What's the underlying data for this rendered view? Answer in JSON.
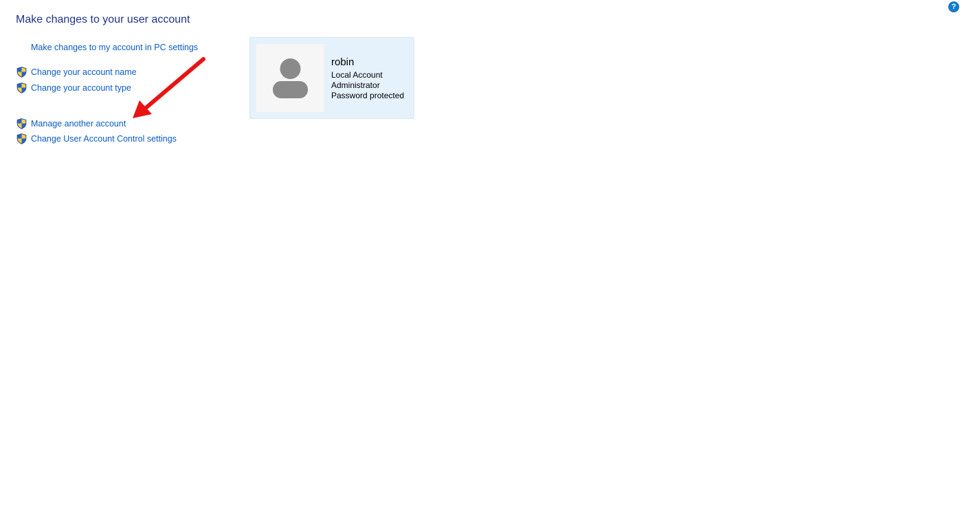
{
  "header": {
    "title": "Make changes to your user account",
    "help_icon": "help-icon",
    "help_label": "?"
  },
  "tasks": {
    "pc_settings": "Make changes to my account in PC settings",
    "change_name": "Change your account name",
    "change_type": "Change your account type",
    "manage_another": "Manage another account",
    "uac_settings": "Change User Account Control settings",
    "shield_icon": "uac-shield-icon"
  },
  "account": {
    "name": "robin",
    "type": "Local Account",
    "role": "Administrator",
    "password_status": "Password protected",
    "avatar_icon": "user-avatar-icon"
  },
  "colors": {
    "title": "#1e3287",
    "link": "#0a5bbf",
    "card_bg": "#e5f1fb",
    "annotation_arrow": "#e81414"
  }
}
